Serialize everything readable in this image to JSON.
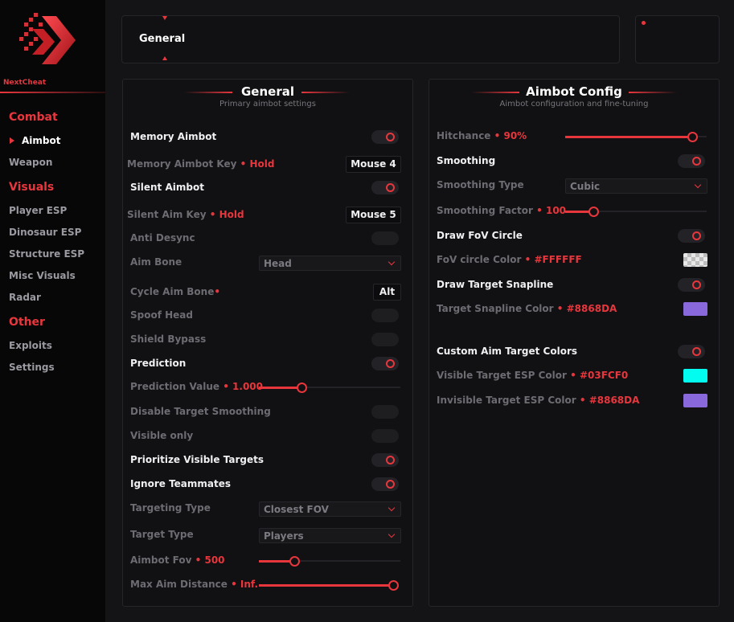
{
  "app": {
    "brand": "NextCheat"
  },
  "sidebar": {
    "groups": [
      {
        "label": "Combat",
        "items": [
          "Aimbot",
          "Weapon"
        ]
      },
      {
        "label": "Visuals",
        "items": [
          "Player ESP",
          "Dinosaur ESP",
          "Structure ESP",
          "Misc Visuals",
          "Radar"
        ]
      },
      {
        "label": "Other",
        "items": [
          "Exploits",
          "Settings"
        ]
      }
    ],
    "active": "Aimbot"
  },
  "tabs": {
    "current": "General"
  },
  "general": {
    "title": "General",
    "subtitle": "Primary aimbot settings",
    "memory_aimbot": "Memory Aimbot",
    "memory_key_label": "Memory Aimbot Key",
    "memory_key_mode": "Hold",
    "memory_key_value": "Mouse 4",
    "silent_aimbot": "Silent Aimbot",
    "silent_key_label": "Silent Aim Key",
    "silent_key_mode": "Hold",
    "silent_key_value": "Mouse 5",
    "anti_desync": "Anti Desync",
    "aim_bone": "Aim Bone",
    "aim_bone_value": "Head",
    "cycle_aim_bone": "Cycle Aim Bone",
    "cycle_aim_bone_key": "Alt",
    "spoof_head": "Spoof Head",
    "shield_bypass": "Shield Bypass",
    "prediction": "Prediction",
    "prediction_value_label": "Prediction Value",
    "prediction_value": "1.000",
    "prediction_fraction": 0.3,
    "disable_target_smoothing": "Disable Target Smoothing",
    "visible_only": "Visible only",
    "prioritize_visible": "Prioritize Visible Targets",
    "ignore_teammates": "Ignore Teammates",
    "targeting_type": "Targeting Type",
    "targeting_type_value": "Closest FOV",
    "target_type": "Target Type",
    "target_type_value": "Players",
    "aimbot_fov_label": "Aimbot Fov",
    "aimbot_fov_value": "500",
    "aimbot_fov_fraction": 0.25,
    "max_distance_label": "Max Aim Distance",
    "max_distance_value": "Inf.",
    "max_distance_fraction": 1.0
  },
  "config": {
    "title": "Aimbot Config",
    "subtitle": "Aimbot configuration and fine-tuning",
    "hitchance_label": "Hitchance",
    "hitchance_value": "90%",
    "hitchance_fraction": 0.9,
    "smoothing": "Smoothing",
    "smoothing_type": "Smoothing Type",
    "smoothing_type_value": "Cubic",
    "smoothing_factor_label": "Smoothing Factor",
    "smoothing_factor_value": "100",
    "smoothing_factor_fraction": 0.2,
    "draw_fov": "Draw FoV Circle",
    "fov_color_label": "FoV circle Color",
    "fov_color_value": "#FFFFFF",
    "draw_snapline": "Draw Target Snapline",
    "snapline_color_label": "Target Snapline Color",
    "snapline_color_value": "#8868DA",
    "custom_colors": "Custom Aim Target Colors",
    "visible_color_label": "Visible Target ESP Color",
    "visible_color_value": "#03FCF0",
    "invisible_color_label": "Invisible Target ESP Color",
    "invisible_color_value": "#8868DA"
  },
  "colors": {
    "accent": "#e8363d",
    "bg": "#141416",
    "panel": "#111113"
  }
}
